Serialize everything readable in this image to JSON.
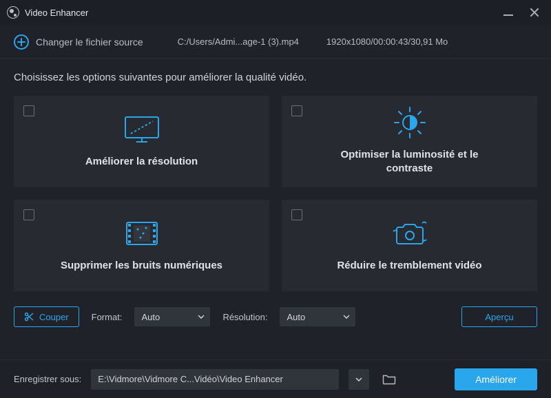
{
  "titlebar": {
    "app_name": "Video Enhancer"
  },
  "source": {
    "change_label": "Changer le fichier source",
    "path": "C:/Users/Admi...age-1 (3).mp4",
    "meta": "1920x1080/00:00:43/30,91 Mo"
  },
  "main": {
    "intro": "Choisissez les options suivantes pour améliorer la qualité vidéo.",
    "cards": [
      {
        "label": "Améliorer la résolution"
      },
      {
        "label": "Optimiser la luminosité et le contraste"
      },
      {
        "label": "Supprimer les bruits numériques"
      },
      {
        "label": "Réduire le tremblement vidéo"
      }
    ]
  },
  "options": {
    "cut_label": "Couper",
    "format_label": "Format:",
    "format_value": "Auto",
    "resolution_label": "Résolution:",
    "resolution_value": "Auto",
    "preview_label": "Aperçu"
  },
  "footer": {
    "save_label": "Enregistrer sous:",
    "save_path": "E:\\Vidmore\\Vidmore C...Vidéo\\Video Enhancer",
    "enhance_label": "Améliorer"
  },
  "colors": {
    "accent": "#2aa6ec"
  }
}
